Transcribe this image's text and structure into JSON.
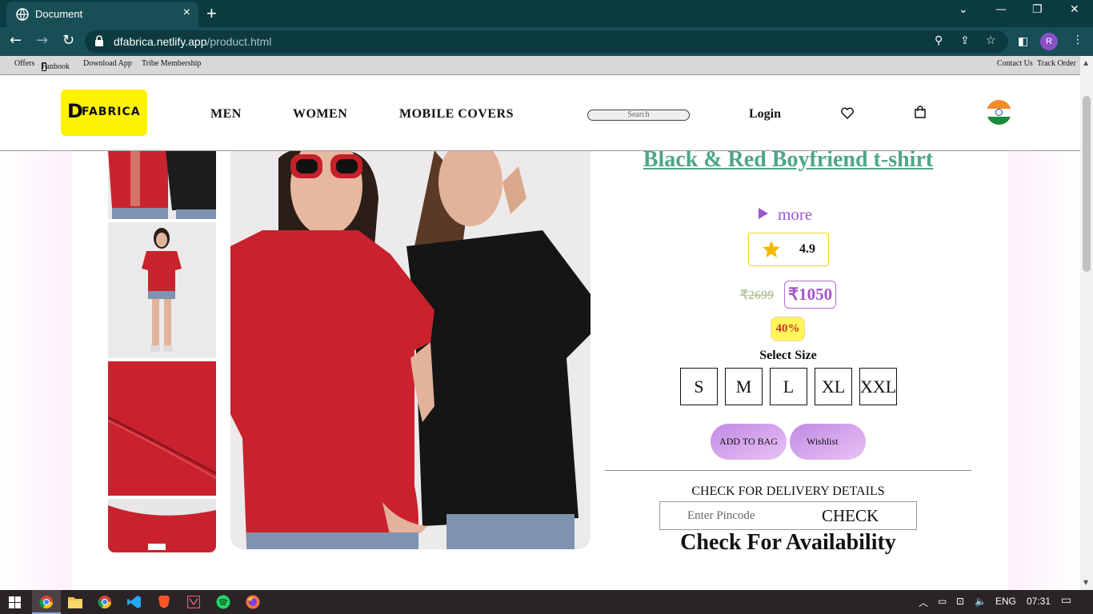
{
  "browser": {
    "tab_title": "Document",
    "tab_close": "×",
    "new_tab": "+",
    "url_host": "dfabrica.netlify.app",
    "url_path": "/product.html",
    "profile_initial": "R"
  },
  "topstrip": {
    "offers": "Offers",
    "fanbook": "Fanbook",
    "download_app": "Download App",
    "tribe": "Tribe Membership",
    "contact": "Contact Us",
    "track": "Track Order"
  },
  "header": {
    "logo_mark": "D",
    "logo_text": "FABRICA",
    "nav": [
      "MEN",
      "WOMEN",
      "MOBILE COVERS"
    ],
    "search_placeholder": "Search",
    "login": "Login"
  },
  "product": {
    "title": "Black & Red Boyfriend t-shirt",
    "more": "more",
    "rating": "4.9",
    "old_price": "₹2699",
    "new_price": "₹1050",
    "discount": "40%",
    "select_size": "Select Size",
    "sizes": [
      "S",
      "M",
      "L",
      "XL",
      "XXL"
    ],
    "add_to_bag": "ADD TO BAG",
    "wishlist": "Wishlist",
    "delivery_heading": "CHECK FOR DELIVERY DETAILS",
    "pincode_placeholder": "Enter Pincode",
    "check": "CHECK",
    "availability": "Check For Availability"
  },
  "taskbar": {
    "language": "ENG",
    "time": "07:31"
  },
  "colors": {
    "title_green": "#4fa58a",
    "accent_purple": "#a256c9",
    "logo_yellow": "#fff200",
    "chrome_teal": "#174f55"
  }
}
